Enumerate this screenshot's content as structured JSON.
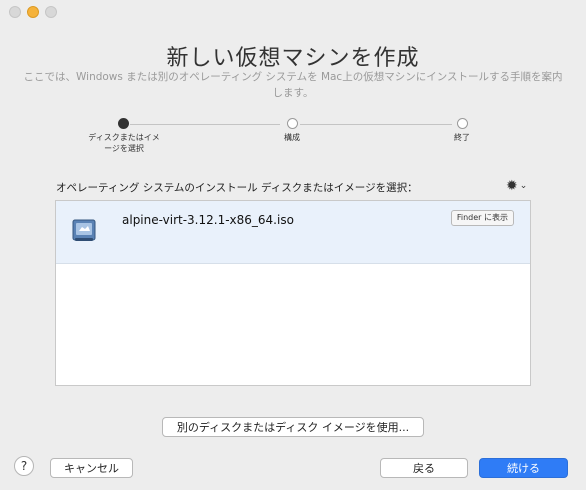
{
  "window": {
    "title": "新しい仮想マシンを作成",
    "subtitle": "ここでは、Windows または別のオペレーティング システムを Mac上の仮想マシンにインストールする手順を案内します。"
  },
  "steps": [
    {
      "label_line1": "ディスクまたはイメ",
      "label_line2": "ージを選択",
      "active": true
    },
    {
      "label_line1": "構成",
      "label_line2": "",
      "active": false
    },
    {
      "label_line1": "終了",
      "label_line2": "",
      "active": false
    }
  ],
  "prompt": "オペレーティング システムのインストール ディスクまたはイメージを選択：",
  "gear_icon": "gear-icon",
  "list": {
    "items": [
      {
        "name": "alpine-virt-3.12.1-x86_64.iso",
        "finder_label": "Finder に表示",
        "icon": "disk-image-icon"
      }
    ]
  },
  "buttons": {
    "use_other": "別のディスクまたはディスク イメージを使用...",
    "cancel": "キャンセル",
    "back": "戻る",
    "continue": "続ける",
    "help": "?"
  },
  "colors": {
    "accent": "#2f7cf6",
    "selected_row": "#e9f1fb"
  }
}
